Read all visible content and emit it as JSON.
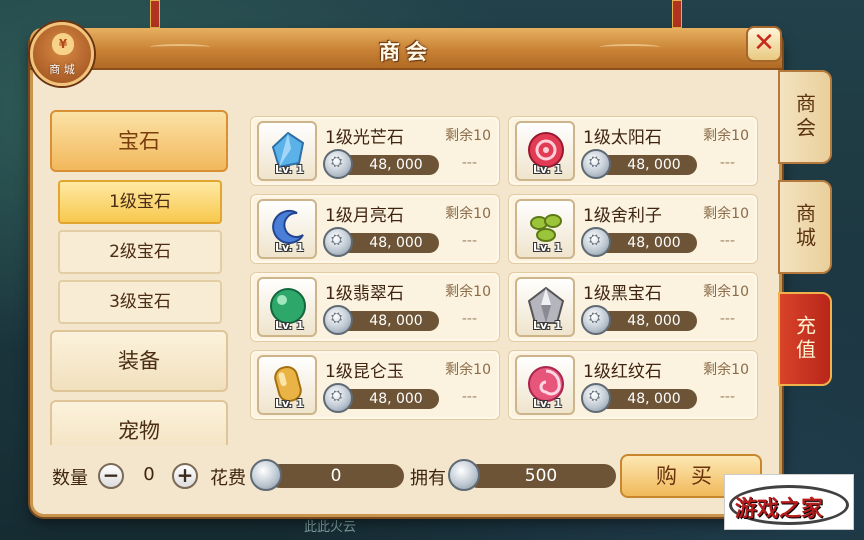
{
  "window": {
    "title": "商会",
    "close_glyph": "✕"
  },
  "shop_badge": {
    "icon_text": "¥",
    "label": "商 城"
  },
  "categories": [
    {
      "label": "宝石",
      "active": true
    },
    {
      "label": "装备"
    },
    {
      "label": "宠物"
    }
  ],
  "subcategories": [
    {
      "label": "1级宝石",
      "active": true
    },
    {
      "label": "2级宝石"
    },
    {
      "label": "3级宝石"
    }
  ],
  "items": [
    {
      "name": "1级光芒石",
      "price": "48, 000",
      "remain": "剩余10",
      "level": "Lv. 1",
      "gem": "blue-crystal-icon",
      "color": "#5bb2e8"
    },
    {
      "name": "1级太阳石",
      "price": "48, 000",
      "remain": "剩余10",
      "level": "Lv. 1",
      "gem": "red-swirl-icon",
      "color": "#e23c55"
    },
    {
      "name": "1级月亮石",
      "price": "48, 000",
      "remain": "剩余10",
      "level": "Lv. 1",
      "gem": "blue-moon-icon",
      "color": "#4a7fd8"
    },
    {
      "name": "1级舍利子",
      "price": "48, 000",
      "remain": "剩余10",
      "level": "Lv. 1",
      "gem": "green-beads-icon",
      "color": "#9cc43a"
    },
    {
      "name": "1级翡翠石",
      "price": "48, 000",
      "remain": "剩余10",
      "level": "Lv. 1",
      "gem": "green-orb-icon",
      "color": "#2ea86a"
    },
    {
      "name": "1级黑宝石",
      "price": "48, 000",
      "remain": "剩余10",
      "level": "Lv. 1",
      "gem": "silver-diamond-icon",
      "color": "#b5b5bd"
    },
    {
      "name": "1级昆仑玉",
      "price": "48, 000",
      "remain": "剩余10",
      "level": "Lv. 1",
      "gem": "amber-jade-icon",
      "color": "#e9b445"
    },
    {
      "name": "1级红纹石",
      "price": "48, 000",
      "remain": "剩余10",
      "level": "Lv. 1",
      "gem": "pink-swirl-icon",
      "color": "#e8557a"
    }
  ],
  "dash": "---",
  "side_tabs": [
    {
      "label": "商会"
    },
    {
      "label": "商城"
    },
    {
      "label": "充值",
      "highlight": true
    }
  ],
  "bottom": {
    "quantity_label": "数量",
    "quantity_value": "0",
    "minus": "−",
    "plus": "+",
    "cost_label": "花费",
    "cost_value": "0",
    "own_label": "拥有",
    "own_value": "500",
    "buy_label": "购买"
  },
  "watermark": {
    "text": "游戏之家",
    "sub": "You Xi Zhi Jia"
  },
  "background_text": "此此火云",
  "colors": {
    "panel": "#f3e6cc",
    "accent": "#c98236",
    "bar": "#6d5436"
  }
}
